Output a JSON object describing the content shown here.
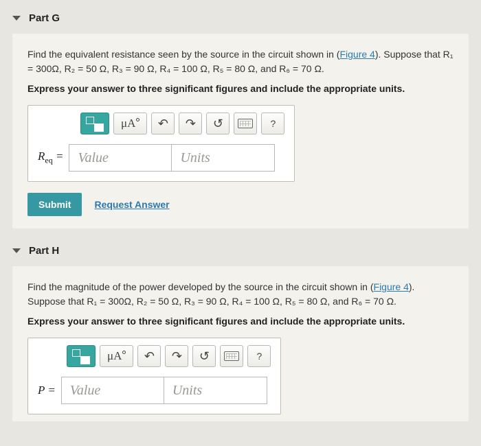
{
  "toolbar": {
    "mu_label": "μA",
    "help_label": "?"
  },
  "placeholders": {
    "value": "Value",
    "units": "Units"
  },
  "buttons": {
    "submit": "Submit",
    "request": "Request Answer"
  },
  "partG": {
    "title": "Part G",
    "prompt_pre": "Find the equivalent resistance seen by the source in the circuit shown in (",
    "figure_link": "Figure 4",
    "prompt_post": "). Suppose that ",
    "given": "R₁ = 300Ω, R₂ = 50 Ω, R₃ = 90 Ω, R₄ = 100 Ω, R₅ = 80 Ω, and R₆ = 70 Ω.",
    "express": "Express your answer to three significant figures and include the appropriate units.",
    "var_label_main": "R",
    "var_label_sub": "eq",
    "var_label_eq": " ="
  },
  "partH": {
    "title": "Part H",
    "prompt_pre": "Find the magnitude of the power developed by the source in the circuit shown in (",
    "figure_link": "Figure 4",
    "prompt_post": "). Suppose that ",
    "given": "R₁ = 300Ω, R₂ = 50 Ω, R₃ = 90 Ω, R₄ = 100 Ω, R₅ = 80 Ω, and R₆ = 70 Ω.",
    "express": "Express your answer to three significant figures and include the appropriate units.",
    "var_label": "P ="
  }
}
